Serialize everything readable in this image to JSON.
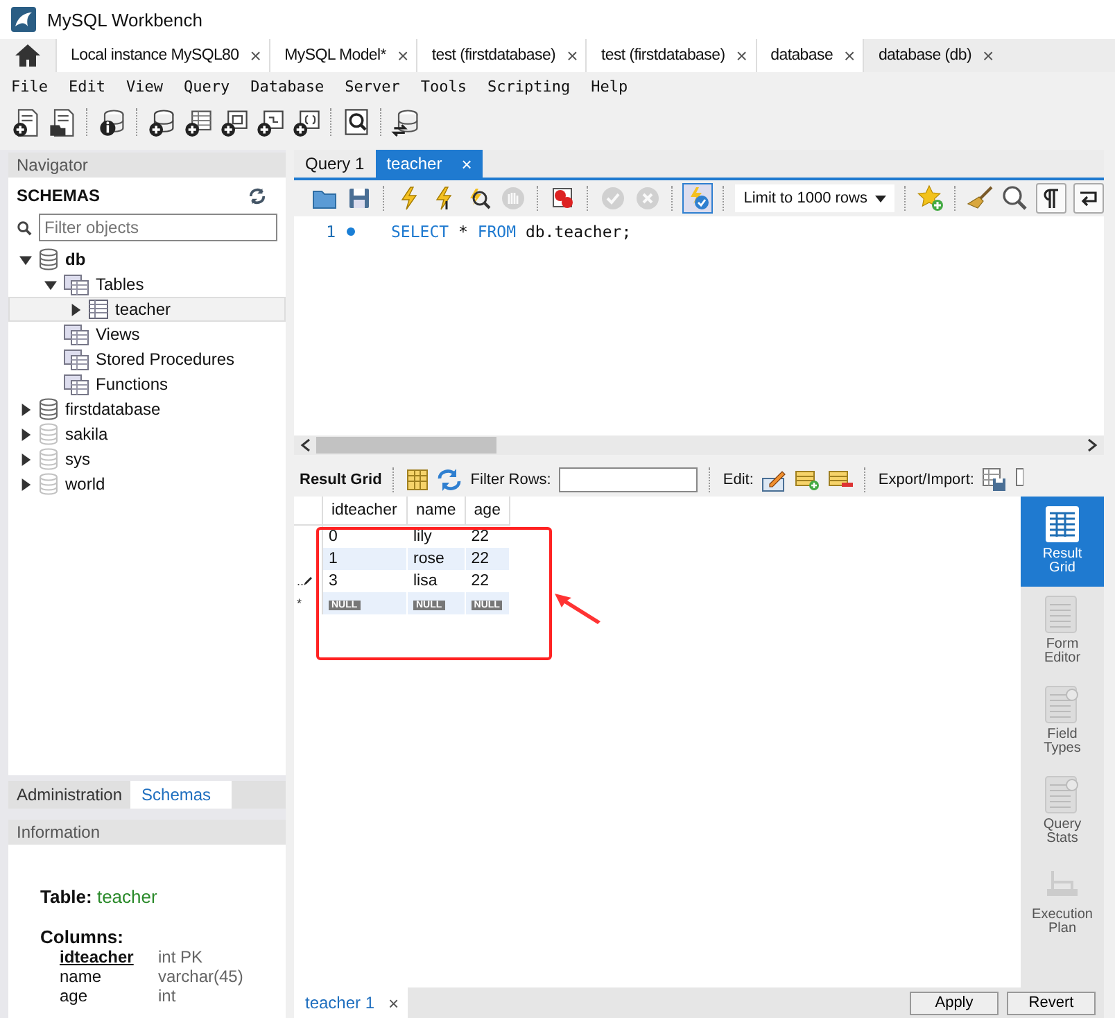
{
  "window": {
    "title": "MySQL Workbench"
  },
  "connection_tabs": [
    {
      "label": "Local instance MySQL80",
      "selected": false,
      "close": "×"
    },
    {
      "label": "MySQL Model*",
      "selected": false,
      "close": "×"
    },
    {
      "label": "test (firstdatabase)",
      "selected": false,
      "close": "×"
    },
    {
      "label": "test (firstdatabase)",
      "selected": false,
      "close": "×"
    },
    {
      "label": "database",
      "selected": false,
      "close": "×"
    },
    {
      "label": "database (db)",
      "selected": true,
      "close": "×"
    }
  ],
  "menu": [
    "File",
    "Edit",
    "View",
    "Query",
    "Database",
    "Server",
    "Tools",
    "Scripting",
    "Help"
  ],
  "navigator": {
    "title": "Navigator",
    "schemas_label": "SCHEMAS",
    "filter": {
      "placeholder": "Filter objects"
    },
    "tree": [
      {
        "label": "db",
        "kind": "schema",
        "default": true,
        "loaded": true,
        "expanded": true,
        "selected": false,
        "children": [
          {
            "label": "Tables",
            "kind": "folder",
            "expanded": true,
            "selected": false,
            "children": [
              {
                "label": "teacher",
                "kind": "table",
                "expanded": false,
                "selected": true
              }
            ]
          },
          {
            "label": "Views",
            "kind": "folder",
            "selected": false
          },
          {
            "label": "Stored Procedures",
            "kind": "folder",
            "selected": false
          },
          {
            "label": "Functions",
            "kind": "folder",
            "selected": false
          }
        ]
      },
      {
        "label": "firstdatabase",
        "kind": "schema",
        "default": false,
        "loaded": true,
        "expanded": false,
        "selected": false
      },
      {
        "label": "sakila",
        "kind": "schema",
        "default": false,
        "loaded": false,
        "expanded": false,
        "selected": false
      },
      {
        "label": "sys",
        "kind": "schema",
        "default": false,
        "loaded": false,
        "expanded": false,
        "selected": false
      },
      {
        "label": "world",
        "kind": "schema",
        "default": false,
        "loaded": false,
        "expanded": false,
        "selected": false
      }
    ],
    "tabs": [
      {
        "label": "Administration",
        "selected": false
      },
      {
        "label": "Schemas",
        "selected": true
      }
    ]
  },
  "information": {
    "title": "Information",
    "table_label": "Table:",
    "table_name": "teacher",
    "columns_label": "Columns:",
    "columns": [
      {
        "name": "idteacher",
        "type": "int PK",
        "primary": true
      },
      {
        "name": "name",
        "type": "varchar(45)",
        "primary": false
      },
      {
        "name": "age",
        "type": "int",
        "primary": false
      }
    ]
  },
  "query_tabs": [
    {
      "label": "Query 1",
      "selected": false
    },
    {
      "label": "teacher",
      "selected": true,
      "close": "×"
    }
  ],
  "editor_toolbar": {
    "buttons": [
      {
        "kind": "open",
        "disabled": false
      },
      {
        "kind": "save",
        "disabled": false
      },
      {
        "kind": "execute",
        "disabled": false
      },
      {
        "kind": "execute_current",
        "disabled": false
      },
      {
        "kind": "explain",
        "disabled": false
      },
      {
        "kind": "stop",
        "disabled": true
      },
      {
        "kind": "error_toggle",
        "disabled": false
      },
      {
        "kind": "commit",
        "disabled": true
      },
      {
        "kind": "rollback",
        "disabled": true
      },
      {
        "kind": "autocommit",
        "disabled": false,
        "on": true
      }
    ],
    "limit": "Limit to 1000 rows"
  },
  "editor": {
    "lines": [
      {
        "number": "1",
        "tokens": [
          {
            "text": "SELECT",
            "kind": "keyword"
          },
          {
            "text": " * ",
            "kind": "plain"
          },
          {
            "text": "FROM",
            "kind": "keyword"
          },
          {
            "text": " db.teacher;",
            "kind": "plain"
          }
        ]
      }
    ]
  },
  "result_toolbar": {
    "title": "Result Grid",
    "filter_label": "Filter Rows:",
    "edit_label": "Edit:",
    "export_label": "Export/Import:"
  },
  "grid": {
    "columns": [
      "idteacher",
      "name",
      "age"
    ],
    "rows": [
      {
        "kind": "data",
        "editing": false,
        "cells": [
          "0",
          "lily",
          "22"
        ]
      },
      {
        "kind": "data",
        "editing": false,
        "cells": [
          "1",
          "rose",
          "22"
        ]
      },
      {
        "kind": "data",
        "editing": true,
        "marker": "..",
        "cells": [
          "3",
          "lisa",
          "22"
        ]
      },
      {
        "kind": "new",
        "editing": false,
        "marker": "*",
        "cells": [
          "NULL",
          "NULL",
          "NULL"
        ]
      }
    ]
  },
  "side_panel": [
    {
      "label": "Result Grid",
      "kind": "grid",
      "selected": true
    },
    {
      "label": "Form Editor",
      "kind": "form",
      "selected": false
    },
    {
      "label": "Field Types",
      "kind": "types",
      "selected": false
    },
    {
      "label": "Query Stats",
      "kind": "stats",
      "selected": false
    },
    {
      "label": "Execution Plan",
      "kind": "plan",
      "selected": false
    }
  ],
  "result_tabs": [
    {
      "label": "teacher 1",
      "selected": true,
      "close": "×"
    }
  ],
  "buttons": [
    "Apply",
    "Revert"
  ]
}
